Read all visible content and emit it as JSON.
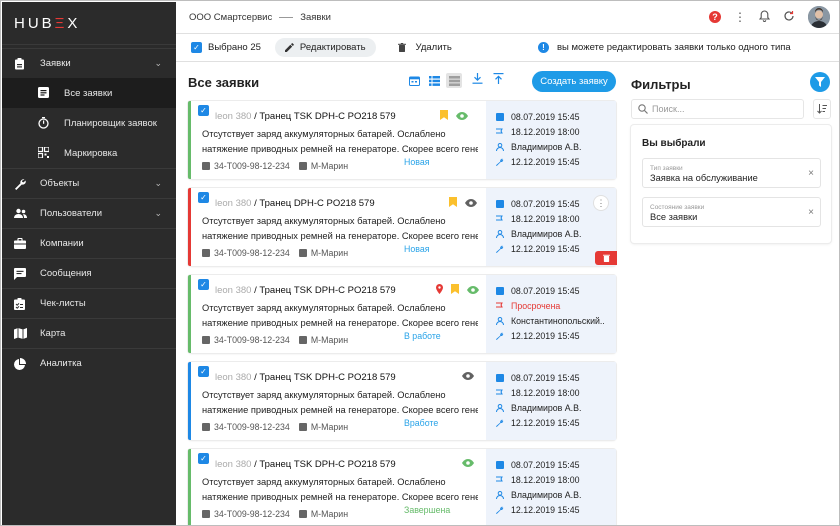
{
  "app": {
    "logo_prefix": "HUB",
    "logo_accent": "Ξ",
    "logo_suffix": "X"
  },
  "sidebar": {
    "items": [
      {
        "label": "Заявки",
        "icon": "clipboard-icon",
        "chevron": "⌄"
      },
      {
        "label": "Все заявки",
        "icon": "list-icon"
      },
      {
        "label": "Планировщик заявок",
        "icon": "timer-icon"
      },
      {
        "label": "Маркировка",
        "icon": "qr-icon"
      },
      {
        "label": "Объекты",
        "icon": "wrench-icon",
        "chevron": "⌄"
      },
      {
        "label": "Пользователи",
        "icon": "users-icon",
        "chevron": "⌄"
      },
      {
        "label": "Компании",
        "icon": "briefcase-icon"
      },
      {
        "label": "Сообщения",
        "icon": "message-icon"
      },
      {
        "label": "Чек-листы",
        "icon": "checklist-icon"
      },
      {
        "label": "Карта",
        "icon": "map-icon"
      },
      {
        "label": "Аналитка",
        "icon": "pie-icon"
      }
    ]
  },
  "header": {
    "company": "ООО Смартсервис",
    "section": "Заявки",
    "help": "?"
  },
  "actionbar": {
    "selected": "Выбрано 25",
    "edit": "Редактировать",
    "delete": "Удалить",
    "info": "вы можете редактировать заявки только одного типа"
  },
  "list": {
    "title": "Все заявки",
    "create": "Создать заявку"
  },
  "cards": [
    {
      "prefix": "leon 380",
      "title": " / Транец TSK DPH-C  PO218 579",
      "desc1": "Отсутствует заряд аккумуляторных батарей. Ослаблено",
      "desc2": "натяжение приводных ремней на генераторе. Скорее всего генер...",
      "code": "34-T009-98-12-234",
      "location": "М-Марин",
      "status": "Новая",
      "created": "08.07.2019  15:45",
      "deadline": "18.12.2019 18:00",
      "assignee": "Владимиров А.В.",
      "done": "12.12.2019  15:45"
    },
    {
      "prefix": "leon 380",
      "title": " / Транец DPH-C  PO218 579",
      "desc1": "Отсутствует заряд аккумуляторных батарей. Ослаблено",
      "desc2": "натяжение приводных ремней на генераторе. Скорее всего генер...",
      "code": "34-T009-98-12-234",
      "location": "М-Марин",
      "status": "Новая",
      "created": "08.07.2019  15:45",
      "deadline": "18.12.2019 18:00",
      "assignee": "Владимиров А.В.",
      "done": "12.12.2019  15:45"
    },
    {
      "prefix": "leon 380",
      "title": " / Транец TSK DPH-C  PO218 579",
      "desc1": "Отсутствует заряд аккумуляторных батарей. Ослаблено",
      "desc2": "натяжение приводных ремней на генераторе. Скорее всего генер...",
      "code": "34-T009-98-12-234",
      "location": "М-Марин",
      "status": "В работе",
      "created": "08.07.2019  15:45",
      "deadline": "Просрочена",
      "assignee": "Константинопольский..",
      "done": "12.12.2019  15:45"
    },
    {
      "prefix": "leon 380",
      "title": " / Транец TSK DPH-C  PO218 579",
      "desc1": "Отсутствует заряд аккумуляторных батарей. Ослаблено",
      "desc2": "натяжение приводных ремней на генераторе. Скорее всего генер...",
      "code": "34-T009-98-12-234",
      "location": "М-Марин",
      "status": "Вработе",
      "created": "08.07.2019  15:45",
      "deadline": "18.12.2019 18:00",
      "assignee": "Владимиров А.В.",
      "done": "12.12.2019  15:45"
    },
    {
      "prefix": "leon 380",
      "title": " / Транец TSK DPH-C  PO218 579",
      "desc1": "Отсутствует заряд аккумуляторных батарей. Ослаблено",
      "desc2": "натяжение приводных ремней на генераторе. Скорее всего генер...",
      "code": "34-T009-98-12-234",
      "location": "М-Марин",
      "status": "Завершена",
      "created": "08.07.2019  15:45",
      "deadline": "18.12.2019 18:00",
      "assignee": "Владимиров А.В.",
      "done": "12.12.2019  15:45"
    }
  ],
  "filters": {
    "title": "Фильтры",
    "search_placeholder": "Поиск...",
    "chosen_title": "Вы выбрали",
    "chips": [
      {
        "label": "Тип заявки",
        "value": "Заявка на обслуживание"
      },
      {
        "label": "Состояние заявки",
        "value": "Все заявки"
      }
    ]
  },
  "colors": {
    "accent": "#1e9be7",
    "danger": "#e53935",
    "done": "#66bb6a",
    "sidebar": "#2b2b2b"
  }
}
